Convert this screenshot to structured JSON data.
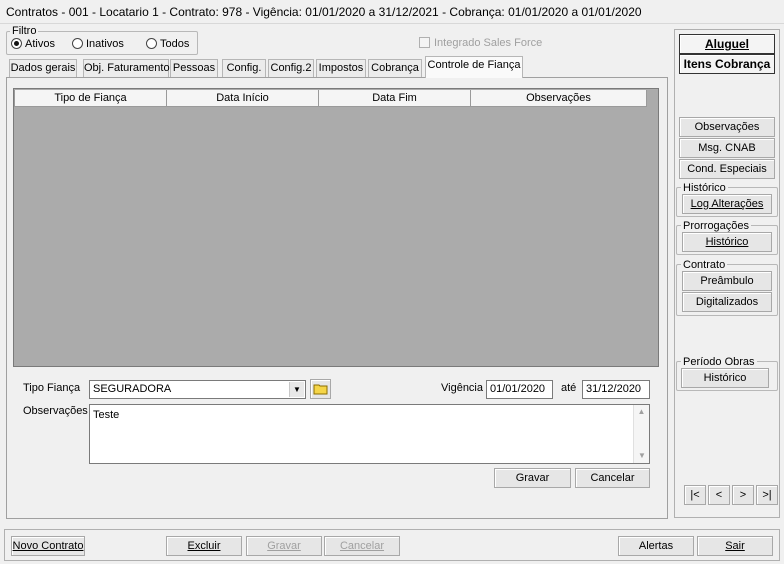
{
  "window": {
    "title": "Contratos - 001 - Locatario 1 - Contrato: 978 - Vigência: 01/01/2020 a 31/12/2021 - Cobrança: 01/01/2020 a 01/01/2020"
  },
  "filter": {
    "label": "Filtro",
    "options": [
      {
        "label": "Ativos",
        "selected": true
      },
      {
        "label": "Inativos",
        "selected": false
      },
      {
        "label": "Todos",
        "selected": false
      }
    ]
  },
  "integrado": {
    "label": "Integrado Sales Force",
    "checked": false
  },
  "tabs": [
    {
      "label": "Dados gerais"
    },
    {
      "label": "Obj. Faturamento"
    },
    {
      "label": "Pessoas"
    },
    {
      "label": "Config."
    },
    {
      "label": "Config.2"
    },
    {
      "label": "Impostos"
    },
    {
      "label": "Cobrança"
    },
    {
      "label": "Controle de Fiança",
      "active": true
    }
  ],
  "grid": {
    "columns": [
      "Tipo de Fiança",
      "Data Início",
      "Data Fim",
      "Observações"
    ],
    "rows": []
  },
  "form": {
    "tipo_label": "Tipo Fiança",
    "tipo_value": "SEGURADORA",
    "vigencia_label": "Vigência",
    "vigencia_start": "01/01/2020",
    "ate_label": "até",
    "vigencia_end": "31/12/2020",
    "obs_label": "Observações",
    "obs_value": "Teste",
    "gravar": "Gravar",
    "cancelar": "Cancelar"
  },
  "sidebar": {
    "aluguel": "Aluguel",
    "itens_cobranca": "Itens Cobrança",
    "observacoes": "Observações",
    "msg_cnab": "Msg. CNAB",
    "cond_especiais": "Cond. Especiais",
    "historico_group": "Histórico",
    "log_alteracoes": "Log Alterações",
    "prorrogacoes_group": "Prorrogações",
    "prorrogacoes_historico": "Histórico",
    "contrato_group": "Contrato",
    "preambulo": "Preâmbulo",
    "digitalizados": "Digitalizados",
    "periodo_obras_group": "Período Obras",
    "periodo_obras_historico": "Histórico",
    "nav": {
      "first": "|<",
      "prev": "<",
      "next": ">",
      "last": ">|"
    }
  },
  "bottom": {
    "novo_contrato": "Novo Contrato",
    "excluir": "Excluir",
    "gravar": "Gravar",
    "cancelar": "Cancelar",
    "alertas": "Alertas",
    "sair": "Sair"
  }
}
